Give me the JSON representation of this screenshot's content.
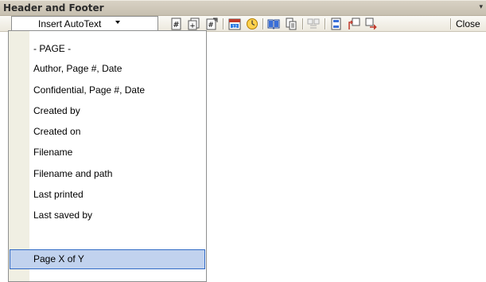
{
  "window": {
    "title": "Header and Footer",
    "menu_arrow": "▾"
  },
  "toolbar": {
    "autotext_label": "Insert AutoText",
    "close_label": "Close",
    "icons": [
      "insert-page-number-icon",
      "insert-number-of-pages-icon",
      "format-page-number-icon",
      "insert-date-icon",
      "insert-time-icon",
      "page-setup-icon",
      "show-hide-document-text-icon",
      "same-as-previous-icon",
      "switch-header-footer-icon",
      "show-previous-icon",
      "show-next-icon"
    ]
  },
  "autotext_menu": {
    "items": [
      "- PAGE -",
      "Author, Page #, Date",
      "Confidential, Page #, Date",
      "Created by",
      "Created on",
      "Filename",
      "Filename and path",
      "Last printed",
      "Last saved by",
      "Page X of Y"
    ],
    "selected_index": 9
  },
  "colors": {
    "selection_fill": "#c1d2ee",
    "selection_border": "#316ac5",
    "menu_gutter": "#f0efe3",
    "titlebar": "#d8d2c4"
  }
}
